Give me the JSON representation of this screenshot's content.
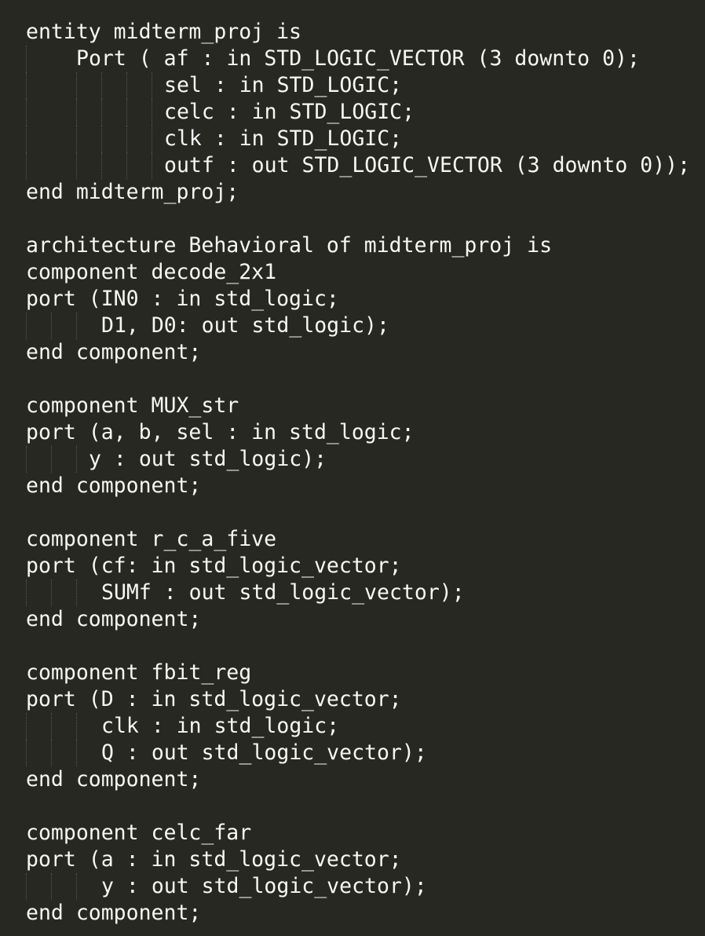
{
  "editor": {
    "background": "#272822",
    "text_color": "#f8f8f2",
    "lines": [
      "entity midterm_proj is",
      "Port ( af : in STD_LOGIC_VECTOR (3 downto 0);",
      "sel : in STD_LOGIC;",
      "celc : in STD_LOGIC;",
      "clk : in STD_LOGIC;",
      "outf : out STD_LOGIC_VECTOR (3 downto 0));",
      "end midterm_proj;",
      "",
      "architecture Behavioral of midterm_proj is",
      "component decode_2x1",
      "port (IN0 : in std_logic;",
      "D1, D0: out std_logic);",
      "end component;",
      "",
      "component MUX_str",
      "port (a, b, sel : in std_logic;",
      "y : out std_logic);",
      "end component;",
      "",
      "component r_c_a_five",
      "port (cf: in std_logic_vector;",
      "SUMf : out std_logic_vector);",
      "end component;",
      "",
      "component fbit_reg",
      "port (D : in std_logic_vector;",
      "clk : in std_logic;",
      "Q : out std_logic_vector);",
      "end component;",
      "",
      "component celc_far",
      "port (a : in std_logic_vector;",
      "y : out std_logic_vector);",
      "end component;"
    ]
  }
}
